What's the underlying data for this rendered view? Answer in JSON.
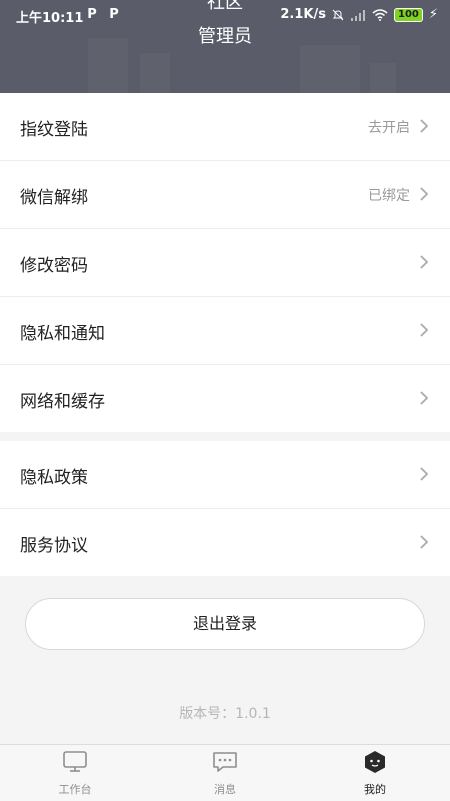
{
  "status_bar": {
    "time": "上午10:11",
    "app_icons": [
      "P",
      "P"
    ],
    "speed": "2.1K/s",
    "battery": "100"
  },
  "header": {
    "name": "社区",
    "role": "管理员"
  },
  "settings_group_1": [
    {
      "label": "指纹登陆",
      "value": "去开启"
    },
    {
      "label": "微信解绑",
      "value": "已绑定"
    },
    {
      "label": "修改密码",
      "value": ""
    },
    {
      "label": "隐私和通知",
      "value": ""
    },
    {
      "label": "网络和缓存",
      "value": ""
    }
  ],
  "settings_group_2": [
    {
      "label": "隐私政策",
      "value": ""
    },
    {
      "label": "服务协议",
      "value": ""
    }
  ],
  "logout_label": "退出登录",
  "version_text": "版本号：1.0.1",
  "tabbar": [
    {
      "label": "工作台",
      "icon": "monitor-icon",
      "active": false
    },
    {
      "label": "消息",
      "icon": "message-icon",
      "active": false
    },
    {
      "label": "我的",
      "icon": "profile-icon",
      "active": true
    }
  ],
  "colors": {
    "header_bg": "#5a5c69",
    "battery": "#7ed321"
  }
}
